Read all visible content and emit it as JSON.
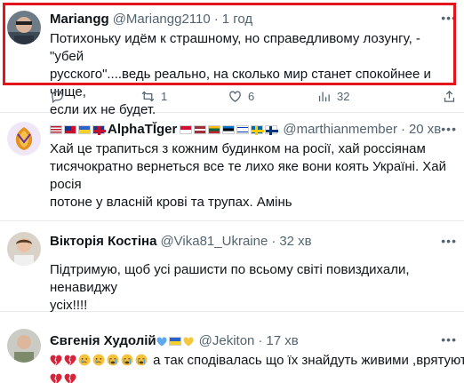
{
  "tweets": [
    {
      "name": "Mariangg",
      "handle": "@Mariangg2110",
      "time": "1 год",
      "lines": [
        "Потихоньку идём к страшному, но справедливому лозунгу, - \"убей",
        "русского\"....ведь реально, на сколько мир станет спокойнее и чище,",
        "если их не будет."
      ],
      "replies": "",
      "retweets": "1",
      "likes": "6",
      "views": "32"
    },
    {
      "name": "AlphaTĬger",
      "handle": "@marthianmember",
      "time": "20 хв",
      "lines": [
        "Хай це трапиться з кожним будинком на росії, хай россіянам",
        "тисячократно вернеться все те лихо яке вони коять Україні. Хай росія",
        "потоне у власній крові та трупах. Амінь"
      ]
    },
    {
      "name": "Вікторія Костіна",
      "handle": "@Vika81_Ukraine",
      "time": "32 хв",
      "lines": [
        "Підтримую, щоб усі рашисти по всьому світі повиздихали, ненавиджу",
        "усіх!!!!"
      ]
    },
    {
      "name": "Євгенія Худолій",
      "handle": "@Jekiton",
      "time": "17 хв",
      "text": "а так сподівалась що їх знайдуть живими ,врятують"
    }
  ],
  "icons": {
    "reply": "reply-icon",
    "retweet": "retweet-icon",
    "like": "heart-icon",
    "views": "views-icon",
    "more": "more-icon"
  },
  "colors": {
    "highlight": "#e3141c",
    "text": "#0f1419",
    "muted": "#536471",
    "divider": "#e7e9ea"
  }
}
